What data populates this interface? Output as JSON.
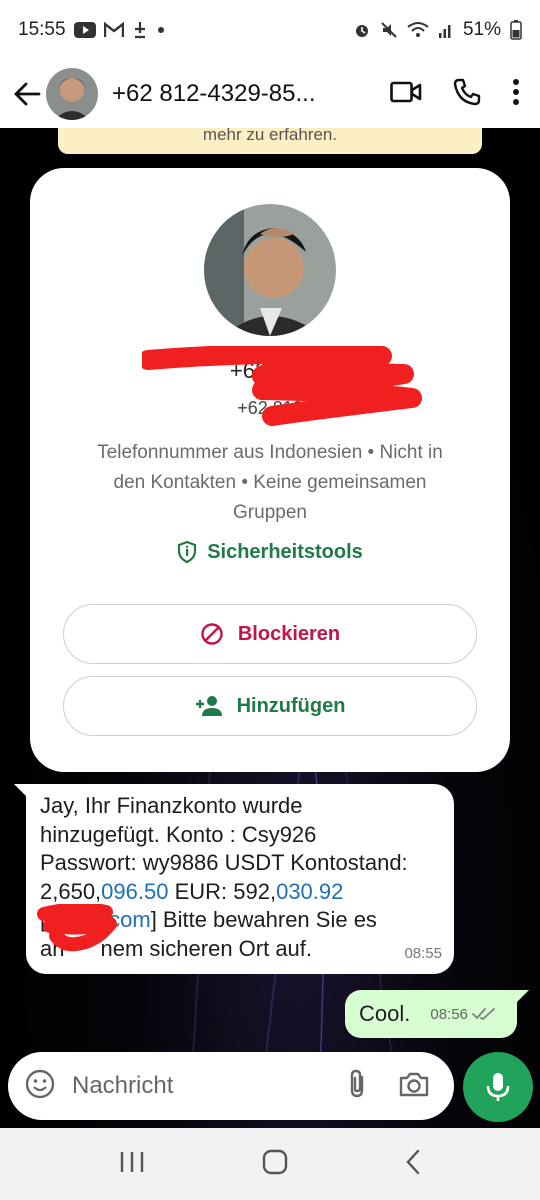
{
  "status_bar": {
    "time": "15:55",
    "battery": "51%",
    "icons": [
      "youtube-icon",
      "gmail-icon",
      "notification-icon",
      "dot-icon",
      "alarm-icon",
      "mute-icon",
      "wifi-icon",
      "signal-icon",
      "battery-icon"
    ]
  },
  "header": {
    "title": "+62 812-4329-85...",
    "icons": [
      "back-arrow-icon",
      "video-call-icon",
      "phone-icon",
      "more-vert-icon"
    ]
  },
  "notice": {
    "text": "mehr zu erfahren."
  },
  "contact_card": {
    "name": "+62 812",
    "phone": "+62 812",
    "info": "Telefonnummer aus Indonesien • Nicht in den Kontakten • Keine gemeinsamen Gruppen",
    "safety_label": "Sicherheitstools",
    "block_label": "Blockieren",
    "add_label": "Hinzufügen"
  },
  "message_in": {
    "line1": "Jay, Ihr Finanzkonto wurde",
    "line2": "hinzugefügt. Konto : Csy926",
    "line3": "Passwort: wy9886 USDT Kontostand:",
    "l4_a": "2,650,",
    "l4_b": "096.50",
    "l4_c": " EUR: 592,",
    "l4_d": "030.92",
    "l5_a": "[",
    "l5_b": "j.com",
    "l5_c": "] Bitte bewahren Sie es",
    "l6_a": "an",
    "l6_b": "nem sicheren Ort auf.",
    "time": "08:55"
  },
  "message_out": {
    "text": "Cool.",
    "time": "08:56"
  },
  "composer": {
    "placeholder": "Nachricht"
  },
  "colors": {
    "accent_green": "#21a35c",
    "danger": "#c0144a",
    "outgoing_bubble": "#d9fdd3",
    "notice": "#fcefc4",
    "redaction": "#f02020"
  }
}
